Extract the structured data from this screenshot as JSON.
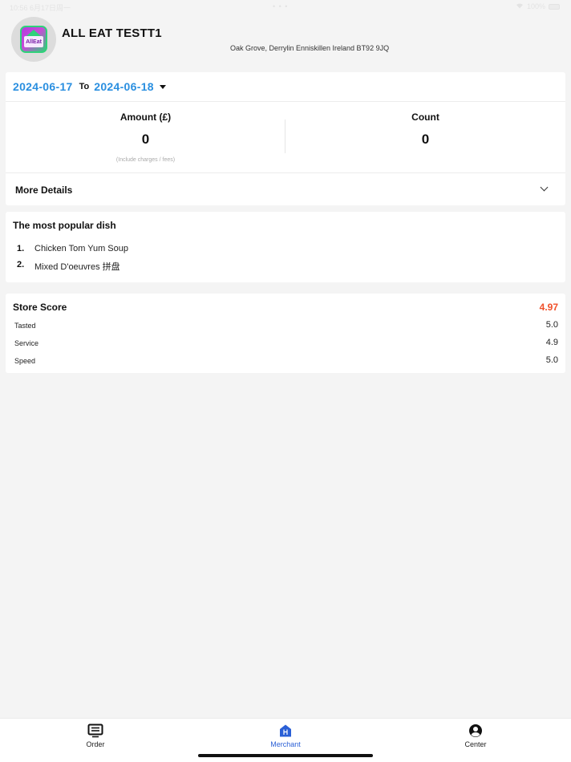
{
  "status_bar": {
    "left": "10:56 6月17日周一",
    "center": "• • •",
    "right": "100%"
  },
  "header": {
    "logo_text": "AllEat",
    "store_name": "ALL EAT TESTT1",
    "address": "Oak Grove, Derrylin Enniskillen Ireland BT92 9JQ"
  },
  "summary": {
    "date_from": "2024-06-17",
    "to_label": "To",
    "date_to": "2024-06-18",
    "amount_label": "Amount (£)",
    "amount_value": "0",
    "amount_note": "(Include charges / fees)",
    "count_label": "Count",
    "count_value": "0",
    "more_details_label": "More Details"
  },
  "popular_dish": {
    "title": "The most popular dish",
    "items": [
      {
        "rank": "1.",
        "name": "Chicken Tom Yum Soup"
      },
      {
        "rank": "2.",
        "name": "Mixed D'oeuvres 拼盘"
      }
    ]
  },
  "store_score": {
    "title": "Store Score",
    "total": "4.97",
    "total_color": "#f0502a",
    "rows": [
      {
        "label": "Tasted",
        "value": "5.0"
      },
      {
        "label": "Service",
        "value": "4.9"
      },
      {
        "label": "Speed",
        "value": "5.0"
      }
    ]
  },
  "tab_bar": {
    "tabs": [
      {
        "label": "Order",
        "icon": "order-list-icon"
      },
      {
        "label": "Merchant",
        "icon": "merchant-store-icon",
        "active": true
      },
      {
        "label": "Center",
        "icon": "user-center-icon"
      }
    ],
    "active_color": "#2a5fd6"
  },
  "colors": {
    "accent_blue": "#2a8fe0",
    "background": "#f4f4f4"
  }
}
